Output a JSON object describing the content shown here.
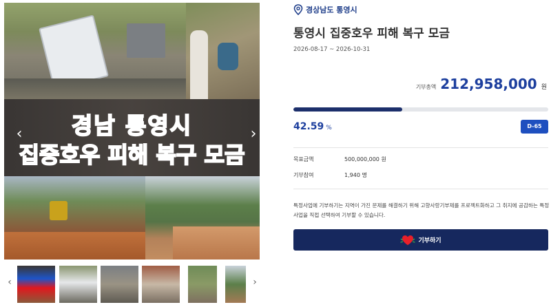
{
  "gallery": {
    "banner_line1": "경남 통영시",
    "banner_line2": "집중호우 피해 복구 모금",
    "prev_icon": "chevron-left-icon",
    "next_icon": "chevron-right-icon",
    "thumbnail_count": 6
  },
  "campaign": {
    "region": "경상남도 통영시",
    "title": "통영시 집중호우 피해 복구 모금",
    "period": "2026-08-17 ~ 2026-10-31",
    "total_label": "기부총액",
    "total_value": "212,958,000",
    "total_unit": "원",
    "progress_percent": 42.59,
    "percent_value": "42.59",
    "percent_symbol": "%",
    "d_day": "D-65",
    "goal_label": "목표금액",
    "goal_value": "500,000,000 원",
    "participants_label": "기부참여",
    "participants_value": "1,940 명",
    "description": "특정사업에 기부하기는 지역이 가진 문제를 해결하기 위해 고향사랑기부제를 프로젝트화하고 그 취지에 공감하는 특정사업을 직접 선택하여 기부할 수 있습니다.",
    "donate_label": "기부하기"
  },
  "colors": {
    "brand_navy": "#16285e",
    "accent_blue": "#1d3f9e",
    "badge_blue": "#1e4fbf",
    "banner_red": "#e0181e"
  }
}
